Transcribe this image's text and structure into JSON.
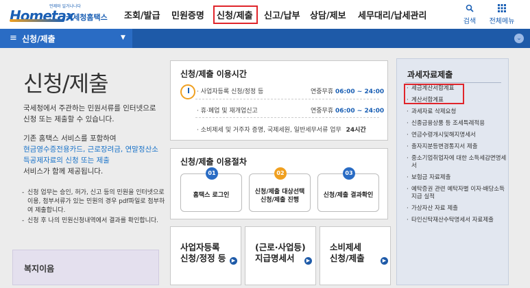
{
  "header": {
    "logo": {
      "tagline": "언제와 일거나나다",
      "brand": "Hometax",
      "sub": "국세청홈택스"
    },
    "nav": [
      {
        "label": "조회/발급"
      },
      {
        "label": "민원증명"
      },
      {
        "label": "신청/제출",
        "active": true
      },
      {
        "label": "신고/납부"
      },
      {
        "label": "상담/제보"
      },
      {
        "label": "세무대리/납세관리"
      }
    ],
    "tools": {
      "search": {
        "icon": "search-icon",
        "label": "검색"
      },
      "all_menu": {
        "icon": "grid-menu-icon",
        "label": "전체메뉴"
      }
    }
  },
  "subbar": {
    "current": "신청/제출"
  },
  "intro": {
    "title": "신청/제출",
    "p1": "국세청에서 주관하는 민원서류를 인터넷으로 신청 또는 제출할 수 있습니다.",
    "p2_lead": "기존 홈택스 서비스를 포함하여",
    "p2_blue": "현금영수증전용카드, 근로장려금, 연말정산소득공제자료의 신청 또는 제출",
    "p2_tail": "서비스가 함께 제공됩니다.",
    "notes": [
      "신청 업무는 승인, 허가, 신고 등의 민원을 인터넷으로 이용, 첨부서류가 있는 민원의 경우 pdf파일로 첨부하여 제출합니다.",
      "신청 후 나의 민원신청내역에서 결과를 확인합니다."
    ],
    "welfare": "복지이음"
  },
  "hours": {
    "title": "신청/제출 이용시간",
    "rows": [
      {
        "label": "· 사업자등록 신청/정정 등",
        "time_lead": "연중무휴",
        "time": "06:00 ~ 24:00"
      },
      {
        "label": "· 휴·폐업 및 재개업신고",
        "time_lead": "연중무휴",
        "time": "06:00 ~ 24:00"
      },
      {
        "label": "· 소비제세 및 거주자 증명, 국제세원, 일반세무서류 업무",
        "time_lead": "",
        "time": "24시간"
      }
    ]
  },
  "procedure": {
    "title": "신청/제출 이용절차",
    "steps": [
      {
        "num": "01",
        "label": "홈택스 로그인",
        "color": "#2a6cc4"
      },
      {
        "num": "02",
        "label": "신청/제출 대상선택 신청/제출 진행",
        "color": "#f0a020"
      },
      {
        "num": "03",
        "label": "신청/제출 결과확인",
        "color": "#2a6cc4"
      }
    ]
  },
  "actions": [
    {
      "label1": "사업자등록",
      "label2": "신청/정정 등"
    },
    {
      "label1": "(근로·사업등)",
      "label2": "지급명세서"
    },
    {
      "label1": "소비제세",
      "label2": "신청/제출"
    }
  ],
  "tax_data": {
    "title": "과세자료제출",
    "items": [
      "세금계산서합계표",
      "계산서합계표",
      "과세자료 삭제요청",
      "신종금융상품 등 조세특례적용",
      "연금수령개시및해지명세서",
      "출자지분등변경통지서 제출",
      "중소기업취업자에 대한 소득세감면명세서",
      "보험금 자료제출",
      "예탁증권 관련 예탁자별 이자·배당소득 지급 실적",
      "가상자산 자료 제출",
      "타인신탁재산수탁명세서 자료제출"
    ]
  },
  "colors": {
    "brand": "#1a5fb4",
    "subbar": "#1e5aa8",
    "highlight": "#e0242a",
    "accent": "#f0a020"
  }
}
